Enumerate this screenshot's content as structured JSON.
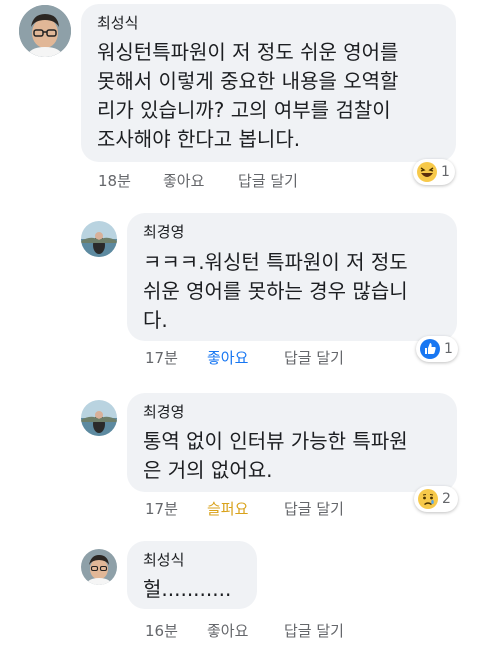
{
  "comments": [
    {
      "author": "최성식",
      "lines": [
        "워싱턴특파원이 저 정도 쉬운 영어를",
        "못해서 이렇게 중요한 내용을 오역할",
        "리가 있습니까? 고의 여부를 검찰이",
        "조사해야 한다고 봅니다."
      ],
      "time": "18분",
      "like": "좋아요",
      "reply": "답글 달기",
      "reaction_icon": "laughing-emoji-icon",
      "reaction_count": "1"
    },
    {
      "author": "최경영",
      "lines": [
        "ㅋㅋㅋ.워싱턴 특파원이 저 정도",
        "쉬운 영어를 못하는 경우 많습니",
        "다."
      ],
      "time": "17분",
      "like": "좋아요",
      "reply": "답글 달기",
      "like_active": true,
      "reaction_icon": "thumbs-up-icon",
      "reaction_count": "1"
    },
    {
      "author": "최경영",
      "lines": [
        "통역 없이 인터뷰 가능한 특파원",
        "은 거의 없어요."
      ],
      "time": "17분",
      "like": "슬퍼요",
      "reply": "답글 달기",
      "sad_active": true,
      "reaction_icon": "sad-emoji-icon",
      "reaction_count": "2"
    },
    {
      "author": "최성식",
      "lines": [
        "헐..........."
      ],
      "time": "16분",
      "like": "좋아요",
      "reply": "답글 달기"
    }
  ],
  "colors": {
    "bubble": "#f0f2f5",
    "like_blue": "#1877f2",
    "sad_yellow": "#d9a21b",
    "meta_gray": "#65676b"
  }
}
